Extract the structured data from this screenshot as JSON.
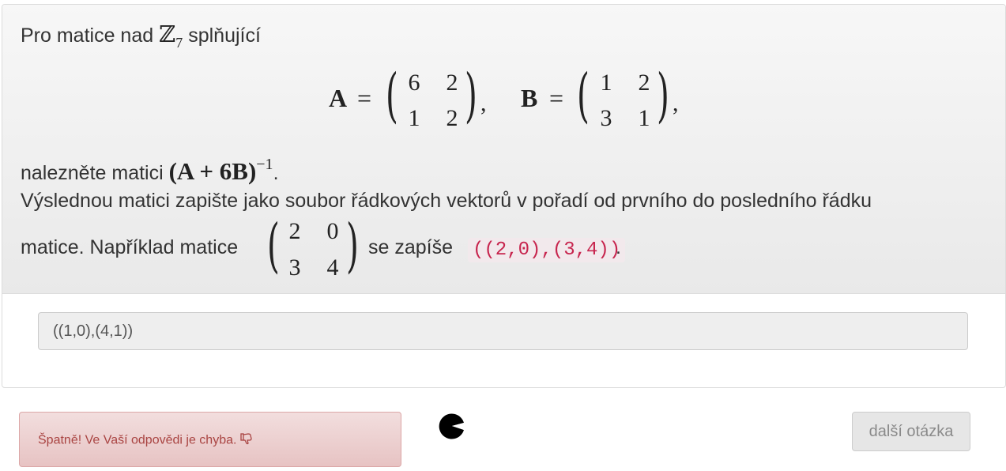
{
  "question": {
    "intro_prefix": "Pro matice nad",
    "field_symbol": "ℤ",
    "field_subscript": "7",
    "intro_suffix": "splňující",
    "matrix_a": {
      "name": "A",
      "rows": [
        [
          "6",
          "2"
        ],
        [
          "1",
          "2"
        ]
      ]
    },
    "matrix_b": {
      "name": "B",
      "rows": [
        [
          "1",
          "2"
        ],
        [
          "3",
          "1"
        ]
      ]
    },
    "equals": "=",
    "comma": ",",
    "task_prefix": "nalezněte matici",
    "task_expression": "(A + 6B)",
    "task_exponent": "−1",
    "task_period": ".",
    "instruction_line1": "Výslednou matici zapište jako soubor řádkových vektorů v pořadí od prvního do posledního řádku",
    "instruction_prefix": "matice. Například matice",
    "example_matrix": {
      "rows": [
        [
          "2",
          "0"
        ],
        [
          "3",
          "4"
        ]
      ]
    },
    "instruction_middle": "se zapíše",
    "example_code": "((2,0),(3,4))",
    "instruction_end": "."
  },
  "answer": {
    "value": "((1,0),(4,1))"
  },
  "feedback": {
    "message": "Špatně! Ve Vaší odpovědi je chyba.",
    "icon": "thumbs-down-icon",
    "color": "#a94442"
  },
  "next_button": {
    "label": "další otázka"
  }
}
